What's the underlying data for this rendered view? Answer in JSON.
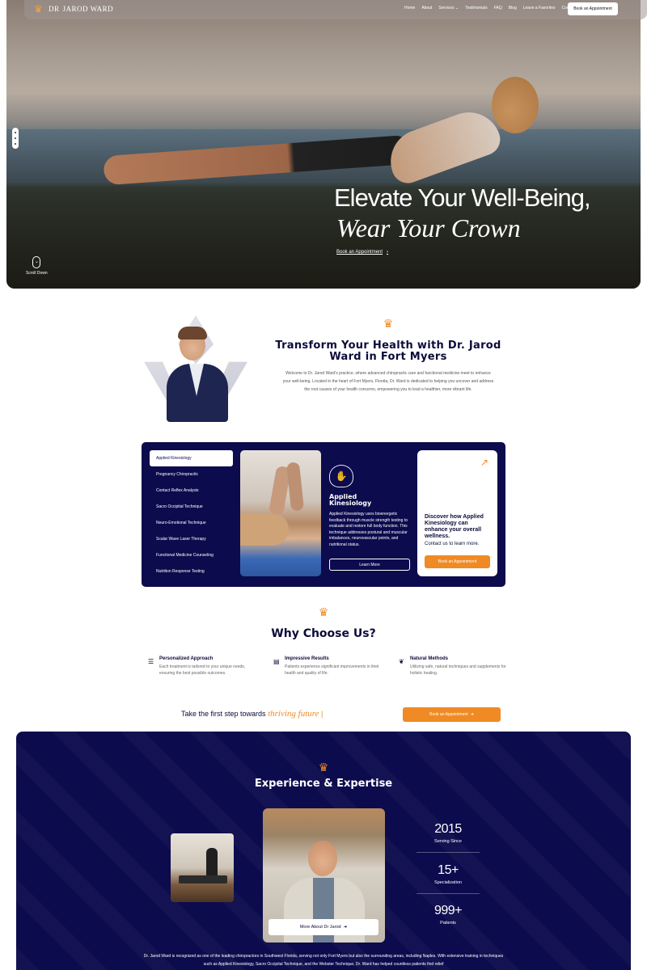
{
  "nav": {
    "logo_prefix": "DR",
    "logo_name": "JAROD WARD",
    "links": [
      "Home",
      "About",
      "Services ⌄",
      "Testimonials",
      "FAQ",
      "Blog",
      "Leave a Favorites",
      "Contact"
    ],
    "book_label": "Book an Appointment"
  },
  "hero": {
    "title": "Elevate Your Well-Being,",
    "subtitle": "Wear Your Crown",
    "cta_label": "Book an Appointment",
    "cta_arrow": "›",
    "scroll_label": "Scroll Down"
  },
  "transform": {
    "title": "Transform Your Health with Dr. Jarod Ward in Fort Myers",
    "text": "Welcome to Dr. Jarod Ward's practice, where advanced chiropractic care and functional medicine meet to enhance your well-being. Located in the heart of Fort Myers, Florida, Dr. Ward is dedicated to helping you uncover and address the root causes of your health concerns, empowering you to lead a healthier, more vibrant life."
  },
  "services": {
    "items": [
      "Applied Kinesiology",
      "Pregnancy Chiropractic",
      "Contact Reflex Analysis",
      "Sacro Occipital Technique",
      "Neuro-Emotional Technique",
      "Scalar Wave Laser Therapy",
      "Functional Medicine Counseling",
      "Nutrition Response Testing"
    ],
    "active_index": 0,
    "detail_name": "Applied Kinesiology",
    "detail_desc": "Applied Kinesiology uses bioenergetic feedback through muscle strength testing to evaluate and restore full body function. This technique addresses postural and muscular imbalances, neurovascular points, and nutritional status.",
    "learn_label": "Learn More",
    "card_title": "Discover how Applied Kinesiology can enhance your overall wellness.",
    "card_contact": "Contact us to learn more.",
    "card_button": "Book an Appointment"
  },
  "why": {
    "title": "Why Choose Us?",
    "features": [
      {
        "title": "Personalized Approach",
        "desc": "Each treatment is tailored to your unique needs, ensuring the best possible outcomes."
      },
      {
        "title": "Impressive Results",
        "desc": "Patients experience significant improvements in their health and quality of life."
      },
      {
        "title": "Natural Methods",
        "desc": "Utilizing safe, natural techniques and supplements for holistic healing."
      }
    ],
    "step_text": "Take the first step towards",
    "step_highlight": "thriving future",
    "step_button": "Book an Appointment"
  },
  "experience": {
    "title": "Experience & Expertise",
    "more_label": "More About Dr Jarod",
    "stats": [
      {
        "value": "2015",
        "label": "Serving Since"
      },
      {
        "value": "15+",
        "label": "Specialization"
      },
      {
        "value": "999+",
        "label": "Patients"
      }
    ],
    "desc": "Dr. Jarod Ward is recognized as one of the leading chiropractors in Southwest Florida, serving not only Fort Myers but also the surrounding areas, including Naples. With extensive training in techniques such as Applied Kinesiology, Sacro Occipital Technique, and the Webster Technique, Dr. Ward has helped countless patients find relief"
  },
  "colors": {
    "navy": "#0c0b4d",
    "accent": "#f08a24"
  }
}
